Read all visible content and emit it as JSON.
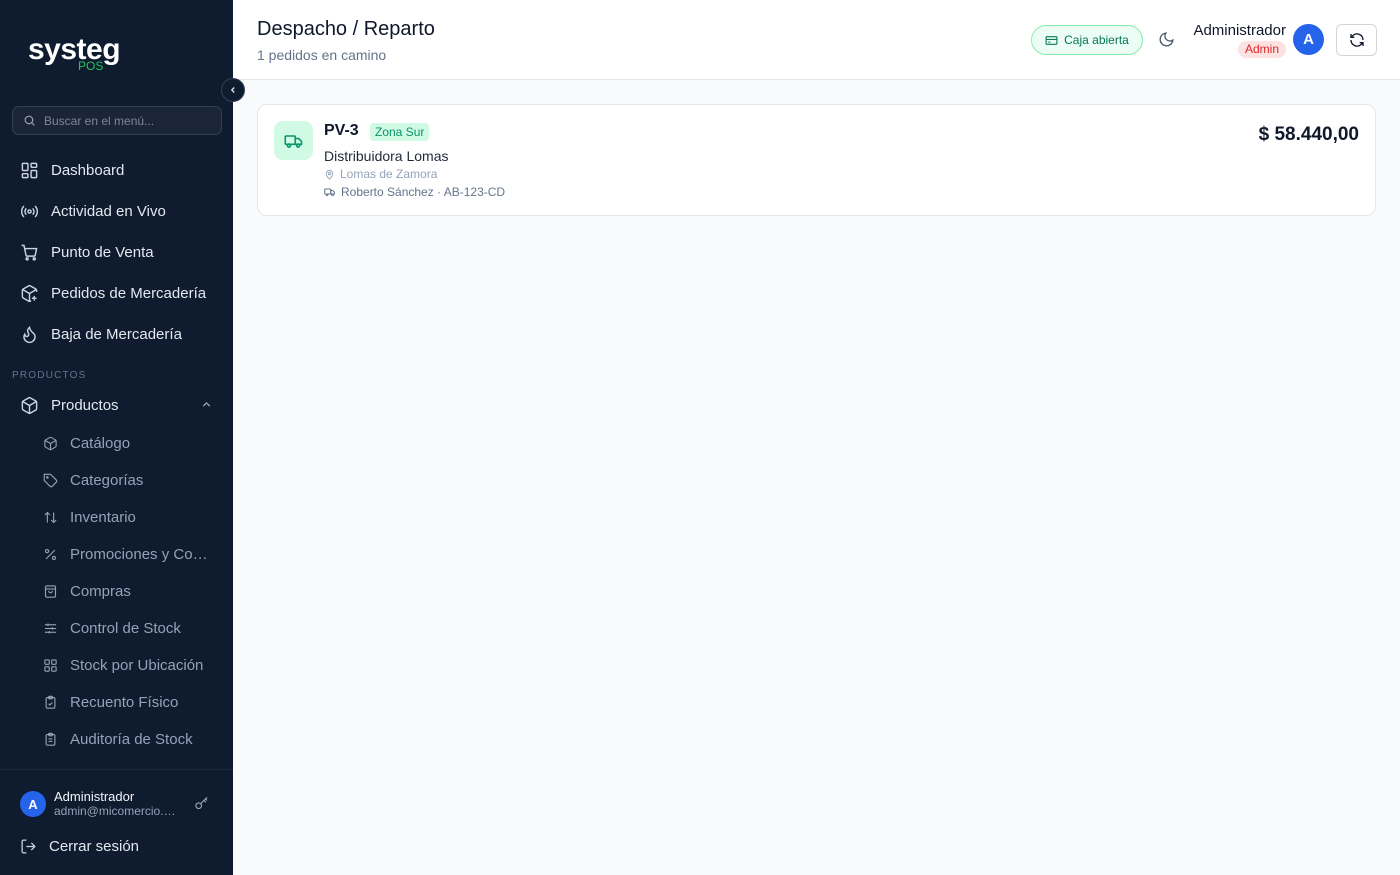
{
  "app": {
    "brand": "systeg",
    "brand_sub": "POS"
  },
  "sidebar": {
    "search_placeholder": "Buscar en el menú...",
    "items": [
      {
        "label": "Dashboard",
        "icon": "dashboard-icon"
      },
      {
        "label": "Actividad en Vivo",
        "icon": "broadcast-icon"
      },
      {
        "label": "Punto de Venta",
        "icon": "cart-icon"
      },
      {
        "label": "Pedidos de Mercadería",
        "icon": "package-plus-icon"
      },
      {
        "label": "Baja de Mercadería",
        "icon": "flame-icon"
      }
    ],
    "section_label": "PRODUCTOS",
    "group": {
      "label": "Productos",
      "icon": "box-icon",
      "expanded": true,
      "children": [
        {
          "label": "Catálogo",
          "icon": "box-icon"
        },
        {
          "label": "Categorías",
          "icon": "tag-icon"
        },
        {
          "label": "Inventario",
          "icon": "arrows-up-down-icon"
        },
        {
          "label": "Promociones y Combos",
          "icon": "percent-icon"
        },
        {
          "label": "Compras",
          "icon": "shopping-bag-icon"
        },
        {
          "label": "Control de Stock",
          "icon": "sliders-icon"
        },
        {
          "label": "Stock por Ubicación",
          "icon": "grid-icon"
        },
        {
          "label": "Recuento Físico",
          "icon": "clipboard-check-icon"
        },
        {
          "label": "Auditoría de Stock",
          "icon": "clipboard-list-icon"
        }
      ]
    },
    "footer": {
      "avatar_initial": "A",
      "user_name": "Administrador",
      "user_email": "admin@micomercio.com",
      "logout_label": "Cerrar sesión"
    }
  },
  "header": {
    "title": "Despacho / Reparto",
    "subtitle": "1 pedidos en camino",
    "cash_status": "Caja abierta",
    "user_name": "Administrador",
    "user_role": "Admin",
    "avatar_initial": "A"
  },
  "orders": [
    {
      "id": "PV-3",
      "zone": "Zona Sur",
      "customer": "Distribuidora Lomas",
      "location": "Lomas de Zamora",
      "driver": "Roberto Sánchez · AB-123-CD",
      "amount": "$ 58.440,00"
    }
  ],
  "colors": {
    "sidebar_bg": "#0f1b2e",
    "accent_green": "#22c55e",
    "avatar_blue": "#2563eb",
    "role_red": "#dc2626"
  }
}
